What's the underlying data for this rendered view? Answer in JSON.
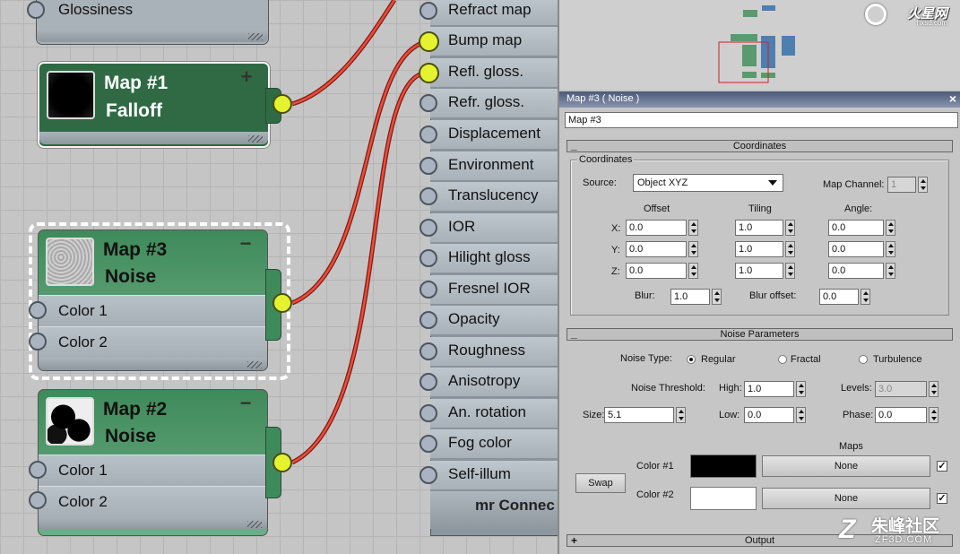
{
  "graph": {
    "top_node": {
      "input_label": "Glossiness"
    },
    "map1": {
      "title": "Map #1",
      "type": "Falloff",
      "control": "+"
    },
    "map3": {
      "title": "Map #3",
      "type": "Noise",
      "control": "−",
      "inputs": [
        "Color 1",
        "Color 2"
      ]
    },
    "map2": {
      "title": "Map #2",
      "type": "Noise",
      "control": "−",
      "inputs": [
        "Color 1",
        "Color 2"
      ]
    },
    "mr_inputs": [
      "Refract map",
      "Bump map",
      "Refl. gloss.",
      "Refr. gloss.",
      "Displacement",
      "Environment",
      "Translucency",
      "IOR",
      "Hilight gloss",
      "Fresnel IOR",
      "Opacity",
      "Roughness",
      "Anisotropy",
      "An. rotation",
      "Fog color",
      "Self-illum"
    ],
    "mr_footer": "mr Connec",
    "colors": {
      "socket_active": "#e4f230",
      "wire": "#e03a2a",
      "node_green": "#2f6a44"
    }
  },
  "navigator": {
    "logo_text": "火星网",
    "logo_sub": "hxsd.com"
  },
  "panel": {
    "title": "Map #3  ( Noise )",
    "name_value": "Map #3",
    "coordinates": {
      "rollout": "Coordinates",
      "group": "Coordinates",
      "source_label": "Source:",
      "source_value": "Object XYZ",
      "map_channel_label": "Map Channel:",
      "map_channel_value": "1",
      "offset_label": "Offset",
      "tiling_label": "Tiling",
      "angle_label": "Angle:",
      "x_label": "X:",
      "y_label": "Y:",
      "z_label": "Z:",
      "offset": [
        "0.0",
        "0.0",
        "0.0"
      ],
      "tiling": [
        "1.0",
        "1.0",
        "1.0"
      ],
      "angle": [
        "0.0",
        "0.0",
        "0.0"
      ],
      "blur_label": "Blur:",
      "blur_value": "1.0",
      "blur_offset_label": "Blur offset:",
      "blur_offset_value": "0.0"
    },
    "noise": {
      "rollout": "Noise Parameters",
      "type_label": "Noise Type:",
      "types": [
        "Regular",
        "Fractal",
        "Turbulence"
      ],
      "selected_type": "Regular",
      "threshold_label": "Noise Threshold:",
      "high_label": "High:",
      "high_value": "1.0",
      "levels_label": "Levels:",
      "levels_value": "3.0",
      "size_label": "Size:",
      "size_value": "5.1",
      "low_label": "Low:",
      "low_value": "0.0",
      "phase_label": "Phase:",
      "phase_value": "0.0",
      "maps_label": "Maps",
      "swap_label": "Swap",
      "color1_label": "Color #1",
      "color1": "#000000",
      "color1_map": "None",
      "color2_label": "Color #2",
      "color2": "#ffffff",
      "color2_map": "None",
      "check": "✓"
    },
    "output_rollout": "Output",
    "output_sign": "+"
  },
  "watermark": {
    "text": "朱峰社区",
    "sub": "ZF3D.COM"
  }
}
